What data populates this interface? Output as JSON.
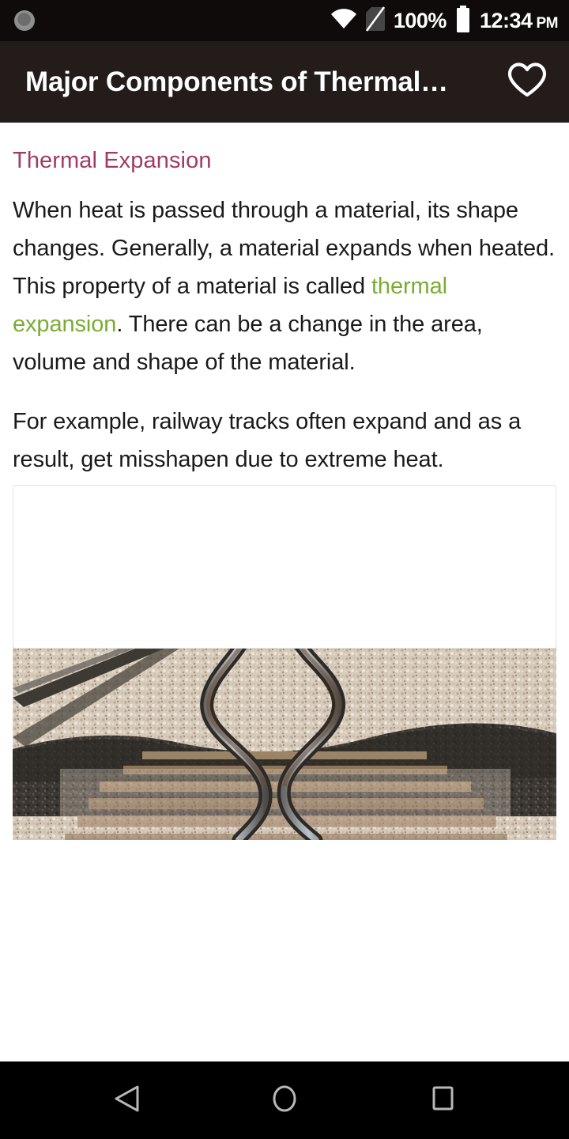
{
  "status_bar": {
    "notification_icon": "sync-circle-icon",
    "wifi_icon": "wifi-full-icon",
    "sim_icon": "no-sim-icon",
    "battery_percent": "100%",
    "battery_icon": "battery-full-icon",
    "time": "12:34",
    "time_period": "PM",
    "background_color": "#0e0b0a"
  },
  "app_bar": {
    "title": "Major Components of Thermal…",
    "favorite_icon": "heart-outline-icon",
    "background_color": "#231c1b",
    "text_color": "#ffffff"
  },
  "article": {
    "heading": "Thermal Expansion",
    "heading_color": "#a03b66",
    "link_color": "#7aac33",
    "paragraph_1": {
      "before_link": "When heat is passed through a material, its shape changes. Generally, a material expands when heated. This property of a material is called ",
      "link_text": "thermal expansion",
      "after_link": ". There can be a change in the area, volume and shape of the material."
    },
    "paragraph_2": "For example, railway tracks often expand and as a result, get misshapen due to extreme heat.",
    "figure": {
      "name": "buckled-railway-tracks-photo",
      "description": "Photograph of railway tracks buckled and bent sideways from heat, with gravel ballast and wooden sleepers, trees and vegetation in the background"
    }
  },
  "ad_card": {
    "name": "ad-placeholder",
    "content": "",
    "border_color": "#e4e4e4"
  },
  "nav_bar": {
    "background_color": "#000000",
    "buttons": [
      {
        "name": "back-button",
        "icon": "triangle-back-icon"
      },
      {
        "name": "home-button",
        "icon": "circle-home-icon"
      },
      {
        "name": "recents-button",
        "icon": "square-recents-icon"
      }
    ]
  }
}
